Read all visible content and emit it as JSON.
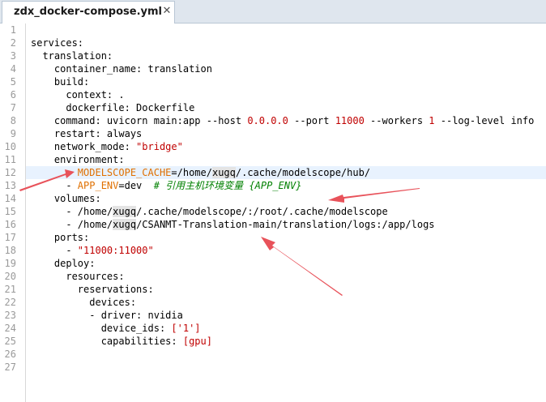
{
  "tab": {
    "title": "zdx_docker-compose.yml",
    "close_icon": "close-icon"
  },
  "colors": {
    "string": "#c00000",
    "env_key": "#e07000",
    "comment": "#008000",
    "annotation_arrow": "#e8525a"
  },
  "lines": [
    {
      "num": "1",
      "segments": []
    },
    {
      "num": "2",
      "segments": [
        {
          "t": "services:",
          "c": ""
        }
      ]
    },
    {
      "num": "3",
      "segments": [
        {
          "t": "  translation:",
          "c": ""
        }
      ]
    },
    {
      "num": "4",
      "segments": [
        {
          "t": "    container_name: translation",
          "c": ""
        }
      ]
    },
    {
      "num": "5",
      "segments": [
        {
          "t": "    build:",
          "c": ""
        }
      ]
    },
    {
      "num": "6",
      "segments": [
        {
          "t": "      context: .",
          "c": ""
        }
      ]
    },
    {
      "num": "7",
      "segments": [
        {
          "t": "      dockerfile: Dockerfile",
          "c": ""
        }
      ]
    },
    {
      "num": "8",
      "segments": [
        {
          "t": "    command: uvicorn main:app --host ",
          "c": ""
        },
        {
          "t": "0.0.0.0",
          "c": "str"
        },
        {
          "t": " --port ",
          "c": ""
        },
        {
          "t": "11000",
          "c": "str"
        },
        {
          "t": " --workers ",
          "c": ""
        },
        {
          "t": "1",
          "c": "str"
        },
        {
          "t": " --log-level info",
          "c": ""
        }
      ]
    },
    {
      "num": "9",
      "segments": [
        {
          "t": "    restart: always",
          "c": ""
        }
      ]
    },
    {
      "num": "10",
      "segments": [
        {
          "t": "    network_mode: ",
          "c": ""
        },
        {
          "t": "\"bridge\"",
          "c": "str"
        }
      ]
    },
    {
      "num": "11",
      "segments": [
        {
          "t": "    environment:",
          "c": ""
        }
      ]
    },
    {
      "num": "12",
      "segments": [
        {
          "t": "      - ",
          "c": ""
        },
        {
          "t": "MODELSCOPE_CACHE",
          "c": "env"
        },
        {
          "t": "=/home/",
          "c": ""
        },
        {
          "t": "xugq",
          "c": "hl"
        },
        {
          "t": "/.cache/modelscope/hub/",
          "c": ""
        }
      ]
    },
    {
      "num": "13",
      "segments": [
        {
          "t": "      - ",
          "c": ""
        },
        {
          "t": "APP_ENV",
          "c": "env"
        },
        {
          "t": "=dev  ",
          "c": ""
        },
        {
          "t": "# 引用主机环境变量 {APP_ENV}",
          "c": "cmt"
        }
      ]
    },
    {
      "num": "14",
      "segments": [
        {
          "t": "    volumes:",
          "c": ""
        }
      ]
    },
    {
      "num": "15",
      "segments": [
        {
          "t": "      - /home/",
          "c": ""
        },
        {
          "t": "xugq",
          "c": "hl"
        },
        {
          "t": "/.cache/modelscope/:/root/.cache/modelscope",
          "c": ""
        }
      ]
    },
    {
      "num": "16",
      "segments": [
        {
          "t": "      - /home/",
          "c": ""
        },
        {
          "t": "xugq",
          "c": "hl"
        },
        {
          "t": "/CSANMT-Translation-main/translation/logs:/app/logs",
          "c": ""
        }
      ]
    },
    {
      "num": "17",
      "segments": [
        {
          "t": "    ports:",
          "c": ""
        }
      ]
    },
    {
      "num": "18",
      "segments": [
        {
          "t": "      - ",
          "c": ""
        },
        {
          "t": "\"11000:11000\"",
          "c": "str"
        }
      ]
    },
    {
      "num": "19",
      "segments": [
        {
          "t": "    deploy:",
          "c": ""
        }
      ]
    },
    {
      "num": "20",
      "segments": [
        {
          "t": "      resources:",
          "c": ""
        }
      ]
    },
    {
      "num": "21",
      "segments": [
        {
          "t": "        reservations:",
          "c": ""
        }
      ]
    },
    {
      "num": "22",
      "segments": [
        {
          "t": "          devices:",
          "c": ""
        }
      ]
    },
    {
      "num": "23",
      "segments": [
        {
          "t": "          - driver: nvidia",
          "c": ""
        }
      ]
    },
    {
      "num": "24",
      "segments": [
        {
          "t": "            device_ids: ",
          "c": ""
        },
        {
          "t": "['1']",
          "c": "str"
        }
      ]
    },
    {
      "num": "25",
      "segments": [
        {
          "t": "            capabilities: ",
          "c": ""
        },
        {
          "t": "[gpu]",
          "c": "str"
        }
      ]
    },
    {
      "num": "26",
      "segments": []
    },
    {
      "num": "27",
      "segments": []
    }
  ]
}
